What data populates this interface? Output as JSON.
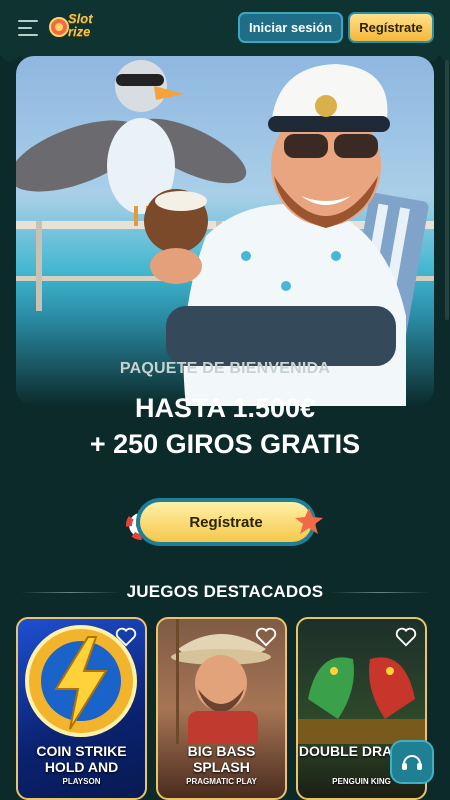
{
  "header": {
    "logo_text": "Slot rize",
    "login_label": "Iniciar sesión",
    "register_label": "Regístrate"
  },
  "hero": {
    "subtitle": "PAQUETE DE BIENVENIDA",
    "title_line1": "HASTA 1.500€",
    "title_line2": "+ 250 GIROS GRATIS",
    "cta_label": "Regístrate"
  },
  "featured": {
    "title": "JUEGOS DESTACADOS",
    "games": [
      {
        "name": "COIN STRIKE HOLD AND",
        "provider": "PLAYSON"
      },
      {
        "name": "BIG BASS SPLASH",
        "provider": "PRAGMATIC PLAY"
      },
      {
        "name": "DOUBLE DRAGON",
        "provider": "PENGUIN KING"
      }
    ]
  },
  "colors": {
    "background": "#0c2a2a",
    "header": "#0f3331",
    "accent_yellow": "#f5c74a",
    "accent_teal": "#1f6d86"
  },
  "icons": [
    "menu-icon",
    "heart-icon",
    "headset-icon",
    "lifebuoy-icon",
    "starfish-icon"
  ]
}
